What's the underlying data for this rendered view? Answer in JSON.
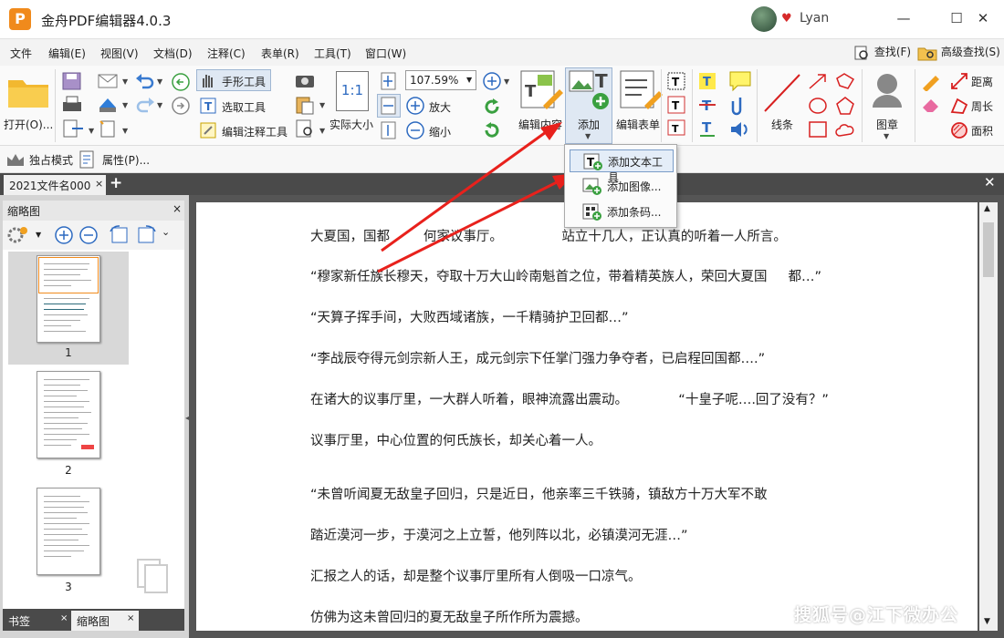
{
  "app": {
    "logo_letter": "P",
    "title": "金舟PDF编辑器4.0.3",
    "user_name": "Lyan",
    "win_minimize": "—",
    "win_maximize": "☐",
    "win_close": "✕"
  },
  "menu": {
    "items": [
      "文件",
      "编辑(E)",
      "视图(V)",
      "文档(D)",
      "注释(C)",
      "表单(R)",
      "工具(T)",
      "窗口(W)"
    ],
    "find_label": "查找(F)",
    "advanced_find_label": "高级查找(S)"
  },
  "ribbon": {
    "open_label": "打开(O)...",
    "hand_tool": "手形工具",
    "select_tool": "选取工具",
    "edit_annotation_tool": "编辑注释工具",
    "actual_size": "实际大小",
    "actual_size_icon": "1:1",
    "zoom_value": "107.59%",
    "zoom_in": "放大",
    "zoom_out": "缩小",
    "edit_content": "编辑内容",
    "add": "添加",
    "edit_form": "编辑表单",
    "line": "线条",
    "stamp": "图章",
    "distance": "距离",
    "perimeter": "周长",
    "area": "面积"
  },
  "subbar": {
    "exclusive_mode": "独占模式",
    "properties": "属性(P)..."
  },
  "tabs": {
    "document_tab": "2021文件名000",
    "close": "×",
    "new": "+",
    "close_all": "✕"
  },
  "left_panel": {
    "title": "缩略图",
    "close": "×",
    "thumbnail_pages": [
      "1",
      "2",
      "3"
    ],
    "bottom_tabs": [
      "书签",
      "缩略图"
    ]
  },
  "add_dropdown": {
    "items": [
      "添加文本工具",
      "添加图像...",
      "添加条码..."
    ]
  },
  "document": {
    "lines": [
      "大夏国，国都        何家议事厅。              站立十几人，正认真的听着一人所言。",
      "“穆家新任族长穆天，夺取十万大山岭南魁首之位，带着精英族人，荣回大夏国     都…”",
      "“天算子挥手间，大败西域诸族，一千精骑护卫回都…”",
      "“李战辰夺得元剑宗新人王，成元剑宗下任掌门强力争夺者，已启程回国都….”",
      "在诸大的议事厅里，一大群人听着，眼神流露出震动。            “十皇子呢….回了没有？”",
      "议事厅里，中心位置的何氏族长，却关心着一人。",
      "“未曾听闻夏无敌皇子回归，只是近日，他亲率三千铁骑，镇敌方十万大军不敢",
      "踏近漠河一步，于漠河之上立誓，他列阵以北，必镇漠河无涯…”",
      "汇报之人的话，却是整个议事厅里所有人倒吸一口凉气。",
      "仿佛为这未曾回归的夏无敌皇子所作所为震撼。"
    ]
  },
  "watermark": "搜狐号@江下微办公",
  "colors": {
    "accent_orange": "#f08a1c",
    "arrow_red": "#e8211c",
    "tab_bar": "#4a4a4a",
    "doc_bg": "#555555"
  }
}
